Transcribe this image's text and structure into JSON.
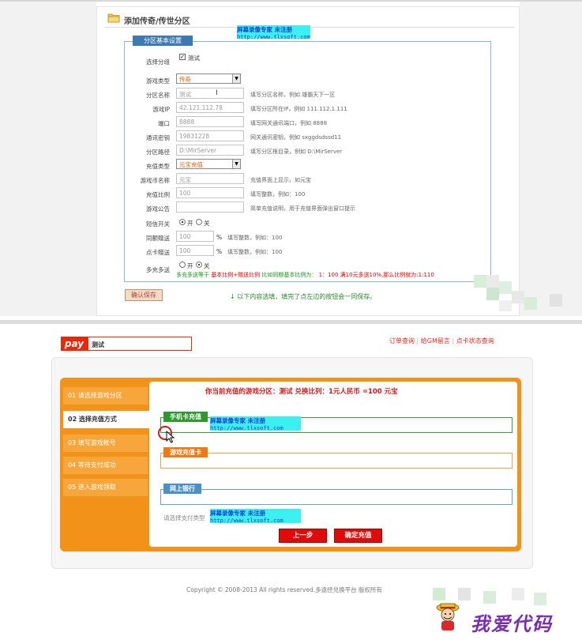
{
  "config_form": {
    "title": "添加传奇/传世分区",
    "section_label": "分区基本设置",
    "fields": {
      "group": {
        "label": "选择分组",
        "checkbox_label": "测试",
        "checked": true
      },
      "game_type": {
        "label": "游戏类型",
        "value": "传奇"
      },
      "zone_name": {
        "label": "分区名称",
        "value": "测试",
        "hint": "填写分区名称，例如 雄霸天下一区"
      },
      "game_ip": {
        "label": "游戏IP",
        "value": "42.121.112.78",
        "hint": "填写分区所在IP，例如 111.112.1.111"
      },
      "port": {
        "label": "端口",
        "value": "8888",
        "hint": "填写网关通讯端口，例如 8888"
      },
      "comm_key": {
        "label": "通讯密钥",
        "value": "19831228",
        "hint": "网关通讯密钥，例如 sxggdsdssd11"
      },
      "zone_path": {
        "label": "分区路径",
        "value": "D:\\MirServer",
        "hint": "填写分区根目录，例如 D:\\MirServer"
      },
      "recharge_type": {
        "label": "充值类型",
        "value": "元宝充值"
      },
      "currency_name": {
        "label": "游戏币名称",
        "value": "元宝",
        "hint": "充值界面上显示，如元宝"
      },
      "recharge_ratio": {
        "label": "充值比例",
        "value": "100",
        "hint": "填写整数，例如：100"
      },
      "game_notice": {
        "label": "游戏公告",
        "value": "",
        "hint": "简单充值说明，用于充值界面弹出窗口提示"
      },
      "sms_switch": {
        "label": "短信开关",
        "on": "开",
        "off": "关"
      },
      "sync_bonus": {
        "label": "同额赠送",
        "value": "100",
        "unit": "%",
        "hint": "填写整数，例如：100"
      },
      "card_bonus": {
        "label": "点卡赠送",
        "value": "100",
        "unit": "%",
        "hint": "填写整数，例如：100"
      },
      "multi_bonus": {
        "label": "多充多送",
        "on": "开",
        "off": "关"
      }
    },
    "formula_prefix": "多充多送等于",
    "formula_red_1": "基本比例+赠送比例",
    "formula_mid": "比如同额基本比例为：",
    "formula_red_2": "1：100 满10元多送10%,那么比例就为:1:110",
    "save_label": "确认保存",
    "tip": "↓ 以下内容选填，填完了点左边的按钮会一同保存。"
  },
  "watermark": {
    "line1": "屏幕录像专家     未注册",
    "line2": "http://www.tlxsoft.com"
  },
  "pay_page": {
    "logo": "pay",
    "zone_name": "测试",
    "top_links": [
      "订单查询",
      "给GM留言",
      "点卡状态查询"
    ],
    "steps": [
      "01 请选择游戏分区",
      "02 选择充值方式",
      "03 填写游戏帐号",
      "04 等待支付成功",
      "05 进入游戏领取"
    ],
    "notice": "你当前充值的游戏分区：测试  兑换比列：1元人民币 =100 元宝",
    "groups": [
      "手机卡充值",
      "游戏充值卡",
      "网上银行"
    ],
    "choose_label": "请选择支付类型",
    "prev_label": "上一步",
    "confirm_label": "确定充值",
    "footer": "Copyright © 2008-2013 All rights reserved.多途径兑换平台 版权所有"
  },
  "brand_text": "我爱代码",
  "colors": {
    "accent_orange": "#f39219",
    "red": "#e00a0a",
    "blue": "#3d79b5",
    "green": "#2e9a2e"
  }
}
